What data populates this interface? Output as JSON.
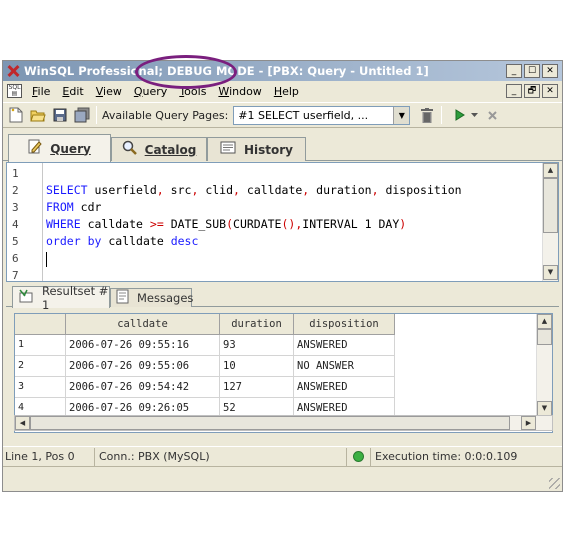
{
  "window": {
    "title": "WinSQL Professional; DEBUG MODE - [PBX: Query - Untitled 1]",
    "controls": [
      "_",
      "☐",
      "✕"
    ]
  },
  "menubar": {
    "items": [
      {
        "label": "File",
        "u": "F",
        "rest": "ile"
      },
      {
        "label": "Edit",
        "u": "E",
        "rest": "dit"
      },
      {
        "label": "View",
        "u": "V",
        "rest": "iew"
      },
      {
        "label": "Query",
        "u": "Q",
        "rest": "uery"
      },
      {
        "label": "Tools",
        "u": "T",
        "rest": "ools"
      },
      {
        "label": "Window",
        "u": "W",
        "rest": "indow"
      },
      {
        "label": "Help",
        "u": "H",
        "rest": "elp"
      }
    ],
    "doc_controls": [
      "_",
      "🗗",
      "✕"
    ]
  },
  "toolbar": {
    "available_label": "Available Query Pages:",
    "query_page_value": "#1   SELECT userfield, ..."
  },
  "tabs": [
    {
      "label": "Query",
      "icon": "pencil-doc-icon"
    },
    {
      "label": "Catalog",
      "icon": "magnifier-icon"
    },
    {
      "label": "History",
      "icon": "history-icon"
    }
  ],
  "editor": {
    "line_numbers": [
      "1",
      "2",
      "3",
      "4",
      "5",
      "6",
      "7"
    ],
    "lines": [
      "",
      "SELECT userfield, src, clid, calldate, duration, disposition",
      "FROM cdr",
      "WHERE calldate >= DATE_SUB(CURDATE(),INTERVAL 1 DAY)",
      "order by calldate desc",
      "",
      ""
    ]
  },
  "result_tabs": [
    {
      "label": "Resultset # 1",
      "icon": "resultset-icon"
    },
    {
      "label": "Messages",
      "icon": "messages-icon"
    }
  ],
  "grid": {
    "columns": [
      "calldate",
      "duration",
      "disposition"
    ],
    "rows": [
      {
        "n": "1",
        "calldate": "2006-07-26 09:55:16",
        "duration": "93",
        "disposition": "ANSWERED"
      },
      {
        "n": "2",
        "calldate": "2006-07-26 09:55:06",
        "duration": "10",
        "disposition": "NO ANSWER"
      },
      {
        "n": "3",
        "calldate": "2006-07-26 09:54:42",
        "duration": "127",
        "disposition": "ANSWERED"
      },
      {
        "n": "4",
        "calldate": "2006-07-26 09:26:05",
        "duration": "52",
        "disposition": "ANSWERED"
      }
    ]
  },
  "status": {
    "position": "Line 1, Pos 0",
    "connection": "Conn.: PBX (MySQL)",
    "execution": "Execution time: 0:0:0.109",
    "connected_color": "#3cb043"
  },
  "highlight_color": "#7a1f7e"
}
